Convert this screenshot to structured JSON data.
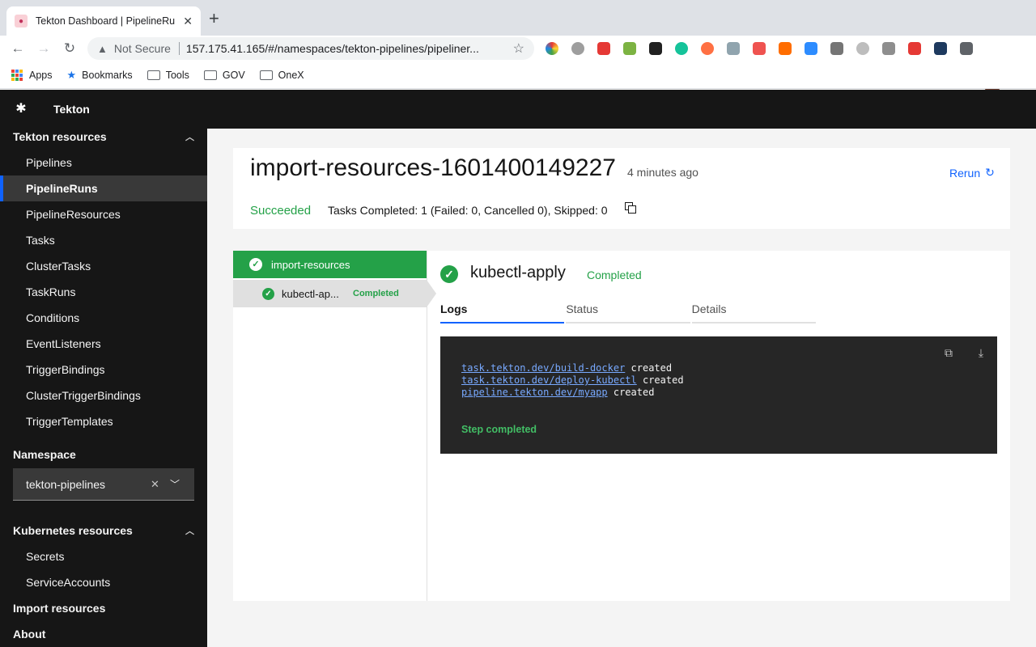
{
  "browser": {
    "tab_title": "Tekton Dashboard | PipelineRu",
    "security_label": "Not Secure",
    "url": "157.175.41.165/#/namespaces/tekton-pipelines/pipeliner..."
  },
  "bookmarks": [
    "Apps",
    "Bookmarks",
    "Tools",
    "GOV",
    "OneX"
  ],
  "app": {
    "name": "Tekton"
  },
  "sidebar": {
    "section_title": "Tekton resources",
    "items": [
      "Pipelines",
      "PipelineRuns",
      "PipelineResources",
      "Tasks",
      "ClusterTasks",
      "TaskRuns",
      "Conditions",
      "EventListeners",
      "TriggerBindings",
      "ClusterTriggerBindings",
      "TriggerTemplates"
    ],
    "active_item": "PipelineRuns",
    "namespace_label": "Namespace",
    "namespace_value": "tekton-pipelines",
    "k8s_section_title": "Kubernetes resources",
    "k8s_items": [
      "Secrets",
      "ServiceAccounts"
    ],
    "import_resources": "Import resources",
    "about": "About"
  },
  "run": {
    "title": "import-resources-1601400149227",
    "age": "4 minutes ago",
    "rerun_label": "Rerun",
    "status": "Succeeded",
    "tasks_summary": "Tasks Completed: 1 (Failed: 0, Cancelled 0), Skipped: 0"
  },
  "task_tree": {
    "task_name": "import-resources",
    "step_name": "kubectl-ap...",
    "step_status": "Completed"
  },
  "step": {
    "name": "kubectl-apply",
    "status": "Completed",
    "tabs": [
      "Logs",
      "Status",
      "Details"
    ],
    "active_tab": "Logs"
  },
  "logs": {
    "lines": [
      {
        "link": "task.tekton.dev/build-docker",
        "text": "created"
      },
      {
        "link": "task.tekton.dev/deploy-kubectl",
        "text": "created"
      },
      {
        "link": "pipeline.tekton.dev/myapp",
        "text": "created"
      }
    ],
    "footer": "Step completed"
  },
  "colors": {
    "success": "#24a148",
    "accent": "#0f62fe",
    "sidebar_bg": "#161616",
    "log_bg": "#262626"
  }
}
